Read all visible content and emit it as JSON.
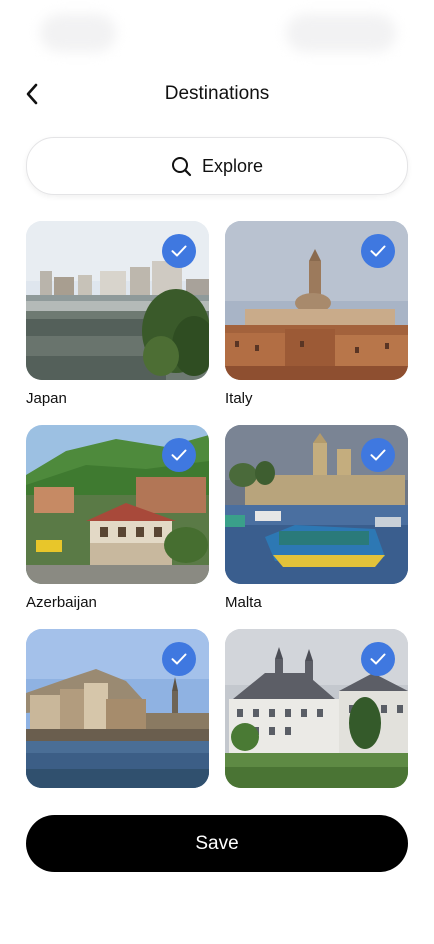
{
  "header": {
    "title": "Destinations",
    "back_icon": "chevron-left-icon"
  },
  "search": {
    "label": "Explore",
    "icon": "search-icon"
  },
  "destinations": [
    {
      "label": "Japan",
      "selected": true
    },
    {
      "label": "Italy",
      "selected": true
    },
    {
      "label": "Azerbaijan",
      "selected": true
    },
    {
      "label": "Malta",
      "selected": true
    },
    {
      "label": "",
      "selected": true
    },
    {
      "label": "",
      "selected": true
    }
  ],
  "footer": {
    "save_label": "Save"
  },
  "colors": {
    "accent": "#3f78e0",
    "primary_button": "#000000"
  }
}
